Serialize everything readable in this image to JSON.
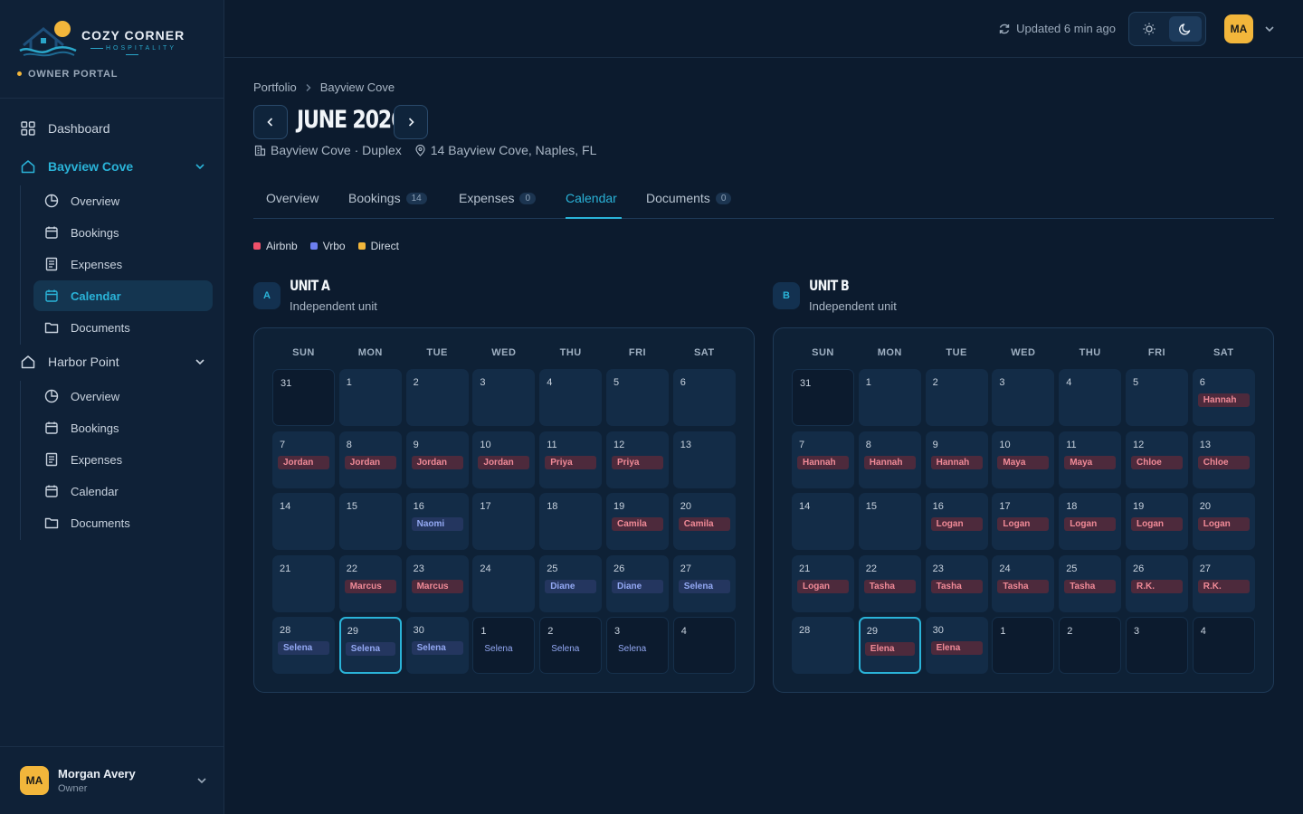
{
  "brand": {
    "name": "COZY CORNER",
    "sub": "HOSPITALITY",
    "portal": "OWNER PORTAL"
  },
  "sidebar": {
    "dashboard": "Dashboard",
    "groups": [
      {
        "label": "Bayview Cove",
        "items": [
          "Overview",
          "Bookings",
          "Expenses",
          "Calendar",
          "Documents"
        ]
      },
      {
        "label": "Harbor Point",
        "items": [
          "Overview",
          "Bookings",
          "Expenses",
          "Calendar",
          "Documents"
        ]
      }
    ],
    "user": {
      "initials": "MA",
      "name": "Morgan Avery",
      "role": "Owner"
    }
  },
  "topbar": {
    "updated": "Updated 6 min ago",
    "avatar": "MA"
  },
  "breadcrumb": [
    "Portfolio",
    "Bayview Cove"
  ],
  "month_title": "JUNE 2026",
  "property": {
    "name": "Bayview Cove · Duplex",
    "address": "14 Bayview Cove, Naples, FL"
  },
  "tabs": [
    {
      "label": "Overview",
      "count": ""
    },
    {
      "label": "Bookings",
      "count": "14"
    },
    {
      "label": "Expenses",
      "count": "0"
    },
    {
      "label": "Calendar",
      "count": ""
    },
    {
      "label": "Documents",
      "count": "0"
    }
  ],
  "legend": [
    {
      "label": "Airbnb",
      "color": "#f0516a"
    },
    {
      "label": "Vrbo",
      "color": "#6d7ff0"
    },
    {
      "label": "Direct",
      "color": "#f2b63b"
    }
  ],
  "weekdays": [
    "SUN",
    "MON",
    "TUE",
    "WED",
    "THU",
    "FRI",
    "SAT"
  ],
  "units": [
    {
      "badge": "A",
      "title": "UNIT A",
      "subtitle": "Independent unit",
      "days": [
        {
          "n": "31",
          "out": true
        },
        {
          "n": "1"
        },
        {
          "n": "2"
        },
        {
          "n": "3"
        },
        {
          "n": "4"
        },
        {
          "n": "5"
        },
        {
          "n": "6"
        },
        {
          "n": "7",
          "g": "Jordan",
          "s": "airbnb"
        },
        {
          "n": "8",
          "g": "Jordan",
          "s": "airbnb"
        },
        {
          "n": "9",
          "g": "Jordan",
          "s": "airbnb"
        },
        {
          "n": "10",
          "g": "Jordan",
          "s": "airbnb"
        },
        {
          "n": "11",
          "g": "Priya",
          "s": "airbnb"
        },
        {
          "n": "12",
          "g": "Priya",
          "s": "airbnb"
        },
        {
          "n": "13"
        },
        {
          "n": "14"
        },
        {
          "n": "15"
        },
        {
          "n": "16",
          "g": "Naomi",
          "s": "vrbo"
        },
        {
          "n": "17"
        },
        {
          "n": "18"
        },
        {
          "n": "19",
          "g": "Camila",
          "s": "airbnb"
        },
        {
          "n": "20",
          "g": "Camila",
          "s": "airbnb"
        },
        {
          "n": "21"
        },
        {
          "n": "22",
          "g": "Marcus",
          "s": "airbnb"
        },
        {
          "n": "23",
          "g": "Marcus",
          "s": "airbnb"
        },
        {
          "n": "24"
        },
        {
          "n": "25",
          "g": "Diane",
          "s": "vrbo"
        },
        {
          "n": "26",
          "g": "Diane",
          "s": "vrbo"
        },
        {
          "n": "27",
          "g": "Selena",
          "s": "vrbo"
        },
        {
          "n": "28",
          "g": "Selena",
          "s": "vrbo"
        },
        {
          "n": "29",
          "g": "Selena",
          "s": "vrbo",
          "today": true
        },
        {
          "n": "30",
          "g": "Selena",
          "s": "vrbo"
        },
        {
          "n": "1",
          "g": "Selena",
          "s": "vrbo",
          "out": true
        },
        {
          "n": "2",
          "g": "Selena",
          "s": "vrbo",
          "out": true
        },
        {
          "n": "3",
          "g": "Selena",
          "s": "vrbo",
          "out": true
        },
        {
          "n": "4",
          "out": true
        }
      ]
    },
    {
      "badge": "B",
      "title": "UNIT B",
      "subtitle": "Independent unit",
      "days": [
        {
          "n": "31",
          "out": true
        },
        {
          "n": "1"
        },
        {
          "n": "2"
        },
        {
          "n": "3"
        },
        {
          "n": "4"
        },
        {
          "n": "5"
        },
        {
          "n": "6",
          "g": "Hannah",
          "s": "airbnb"
        },
        {
          "n": "7",
          "g": "Hannah",
          "s": "airbnb"
        },
        {
          "n": "8",
          "g": "Hannah",
          "s": "airbnb"
        },
        {
          "n": "9",
          "g": "Hannah",
          "s": "airbnb"
        },
        {
          "n": "10",
          "g": "Maya",
          "s": "airbnb"
        },
        {
          "n": "11",
          "g": "Maya",
          "s": "airbnb"
        },
        {
          "n": "12",
          "g": "Chloe",
          "s": "airbnb"
        },
        {
          "n": "13",
          "g": "Chloe",
          "s": "airbnb"
        },
        {
          "n": "14"
        },
        {
          "n": "15"
        },
        {
          "n": "16",
          "g": "Logan",
          "s": "airbnb"
        },
        {
          "n": "17",
          "g": "Logan",
          "s": "airbnb"
        },
        {
          "n": "18",
          "g": "Logan",
          "s": "airbnb"
        },
        {
          "n": "19",
          "g": "Logan",
          "s": "airbnb"
        },
        {
          "n": "20",
          "g": "Logan",
          "s": "airbnb"
        },
        {
          "n": "21",
          "g": "Logan",
          "s": "airbnb"
        },
        {
          "n": "22",
          "g": "Tasha",
          "s": "airbnb"
        },
        {
          "n": "23",
          "g": "Tasha",
          "s": "airbnb"
        },
        {
          "n": "24",
          "g": "Tasha",
          "s": "airbnb"
        },
        {
          "n": "25",
          "g": "Tasha",
          "s": "airbnb"
        },
        {
          "n": "26",
          "g": "R.K.",
          "s": "airbnb"
        },
        {
          "n": "27",
          "g": "R.K.",
          "s": "airbnb"
        },
        {
          "n": "28"
        },
        {
          "n": "29",
          "g": "Elena",
          "s": "airbnb",
          "today": true
        },
        {
          "n": "30",
          "g": "Elena",
          "s": "airbnb"
        },
        {
          "n": "1",
          "out": true
        },
        {
          "n": "2",
          "out": true
        },
        {
          "n": "3",
          "out": true
        },
        {
          "n": "4",
          "out": true
        }
      ]
    }
  ]
}
